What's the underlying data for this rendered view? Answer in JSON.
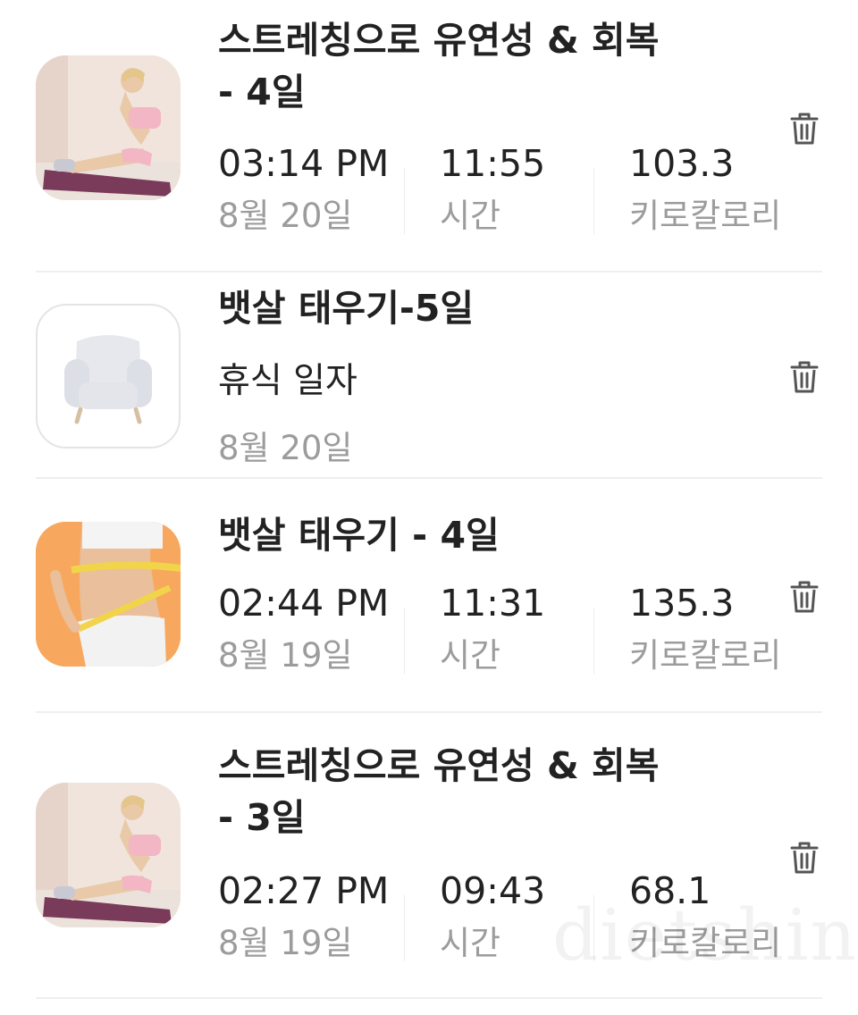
{
  "entries": [
    {
      "title_line1": "스트레칭으로 유연성 & 회복",
      "title_line2": "- 4일",
      "time": "03:14 PM",
      "date": "8월 20일",
      "duration": "11:55",
      "duration_label": "시간",
      "calories": "103.3",
      "calories_label": "키로칼로리"
    },
    {
      "title": "뱃살 태우기-5일",
      "status": "휴식 일자",
      "date": "8월 20일"
    },
    {
      "title": "뱃살 태우기 - 4일",
      "time": "02:44 PM",
      "date": "8월 19일",
      "duration": "11:31",
      "duration_label": "시간",
      "calories": "135.3",
      "calories_label": "키로칼로리"
    },
    {
      "title_line1": "스트레칭으로 유연성 & 회복",
      "title_line2": "- 3일",
      "time": "02:27 PM",
      "date": "8월 19일",
      "duration": "09:43",
      "duration_label": "시간",
      "calories": "68.1",
      "calories_label": "키로칼로리"
    }
  ],
  "watermark": "dietshin.com",
  "icons": [
    "stretching-thumbnail",
    "armchair-thumbnail",
    "belly-fat-thumbnail",
    "trash-icon"
  ]
}
